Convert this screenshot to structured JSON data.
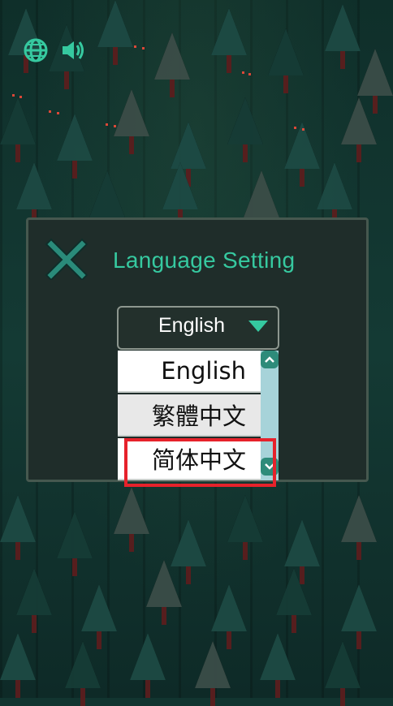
{
  "panel": {
    "title": "Language Setting",
    "selected_language": "English",
    "options": [
      "English",
      "繁體中文",
      "简体中文"
    ]
  },
  "icons": {
    "globe": "globe-icon",
    "sound": "speaker-icon",
    "close": "close-icon"
  },
  "colors": {
    "accent": "#36c9a0",
    "panel_bg": "#1f2d2a",
    "highlight": "#e6222b"
  }
}
